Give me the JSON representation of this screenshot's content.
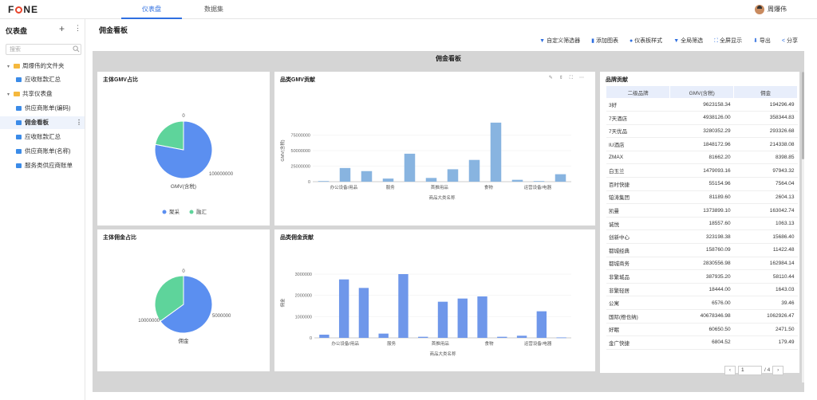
{
  "app": {
    "logo": "FONE",
    "tabs": [
      {
        "label": "仪表盘",
        "active": true
      },
      {
        "label": "数据集",
        "active": false
      }
    ],
    "user_name": "周爆伟"
  },
  "sidebar": {
    "title": "仪表盘",
    "search_placeholder": "搜索",
    "items": [
      {
        "label": "周爆伟的文件夹",
        "type": "folder",
        "level": 0
      },
      {
        "label": "应收账款汇总",
        "type": "dashboard",
        "level": 1
      },
      {
        "label": "共享仪表盘",
        "type": "folder",
        "level": 0
      },
      {
        "label": "供应商账单(编码)",
        "type": "dashboard",
        "level": 1
      },
      {
        "label": "佣金看板",
        "type": "dashboard",
        "level": 1,
        "active": true
      },
      {
        "label": "应收账款汇总",
        "type": "dashboard",
        "level": 1
      },
      {
        "label": "供应商账单(名称)",
        "type": "dashboard",
        "level": 1
      },
      {
        "label": "服务类供应商账单",
        "type": "dashboard",
        "level": 1
      }
    ]
  },
  "main": {
    "title": "佣金看板",
    "toolbar": [
      "自定义筛选器",
      "添加图表",
      "仪表板样式",
      "全局筛选",
      "全屏显示",
      "导出",
      "分享"
    ],
    "canvas_title": "佣金看板"
  },
  "colors": {
    "accent": "#2f6fe0",
    "pie_blue": "#5b8ff0",
    "pie_green": "#5ed49b",
    "bar_blue": "#6f97ea",
    "bar_light": "#88b4e0"
  },
  "chart_data": [
    {
      "type": "pie",
      "title": "主体GMV占比",
      "xlabel": "GMV(含税)",
      "series": [
        {
          "name": "聚采",
          "value": 100000000
        },
        {
          "name": "融汇",
          "value": 0
        }
      ],
      "labels": [
        "0",
        "100000000"
      ],
      "legend": [
        "聚采",
        "融汇"
      ]
    },
    {
      "type": "bar",
      "title": "品类GMV贡献",
      "xlabel": "商品大类名称",
      "ylabel": "GMV(含税)",
      "y_ticks": [
        "0",
        "25000000",
        "50000000",
        "75000000"
      ],
      "x_tick_labels": [
        "办公设备/用品",
        "服务",
        "首推用品",
        "食物",
        "运营设备/电器"
      ],
      "values": [
        1000000,
        22000000,
        17000000,
        5000000,
        45000000,
        6000000,
        20000000,
        35000000,
        95000000,
        3000000,
        1000000,
        12000000
      ]
    },
    {
      "type": "table",
      "title": "品牌贡献",
      "columns": [
        "二级品牌",
        "GMV(含税)",
        "佣金"
      ],
      "rows": [
        [
          "3好",
          "9623158.34",
          "194296.49"
        ],
        [
          "7天酒店",
          "4938126.00",
          "358344.83"
        ],
        [
          "7天优品",
          "3280352.29",
          "293326.68"
        ],
        [
          "IU酒店",
          "1848172.96",
          "214338.08"
        ],
        [
          "ZMAX",
          "81662.20",
          "8398.85"
        ],
        [
          "白玉兰",
          "1479093.16",
          "97943.32"
        ],
        [
          "百时快捷",
          "55154.96",
          "7564.04"
        ],
        [
          "铂涛集团",
          "81189.60",
          "2604.13"
        ],
        [
          "凯曼",
          "1373899.10",
          "163042.74"
        ],
        [
          "诚悦",
          "18557.60",
          "1063.13"
        ],
        [
          "创新中心",
          "323198.38",
          "15686.40"
        ],
        [
          "都城经典",
          "158760.09",
          "11422.48"
        ],
        [
          "都城商务",
          "2830556.98",
          "162984.14"
        ],
        [
          "非繁城品",
          "387935.20",
          "58110.44"
        ],
        [
          "非繁轻居",
          "18444.00",
          "1643.03"
        ],
        [
          "公寓",
          "6576.00",
          "39.46"
        ],
        [
          "国际(橙也纳)",
          "40678346.98",
          "1062926.47"
        ],
        [
          "好眠",
          "60650.50",
          "2471.50"
        ],
        [
          "金广快捷",
          "6804.52",
          "179.49"
        ]
      ],
      "pager": {
        "page": "1",
        "total": "/ 4"
      }
    },
    {
      "type": "pie",
      "title": "主体佣金占比",
      "xlabel": "佣金",
      "series": [
        {
          "name": "聚采",
          "value": 5000000
        },
        {
          "name": "融汇",
          "value": 10000000
        }
      ],
      "labels": [
        "0",
        "5000000",
        "10000000"
      ]
    },
    {
      "type": "bar",
      "title": "品类佣金贡献",
      "xlabel": "商品大类名称",
      "ylabel": "佣金",
      "y_ticks": [
        "0",
        "1000000",
        "2000000",
        "3000000"
      ],
      "x_tick_labels": [
        "办公设备/用品",
        "服务",
        "首推用品",
        "食物",
        "运营设备/电器"
      ],
      "values": [
        150000,
        2750000,
        2350000,
        200000,
        3000000,
        50000,
        1700000,
        1850000,
        1950000,
        50000,
        100000,
        1250000,
        20000
      ]
    }
  ]
}
